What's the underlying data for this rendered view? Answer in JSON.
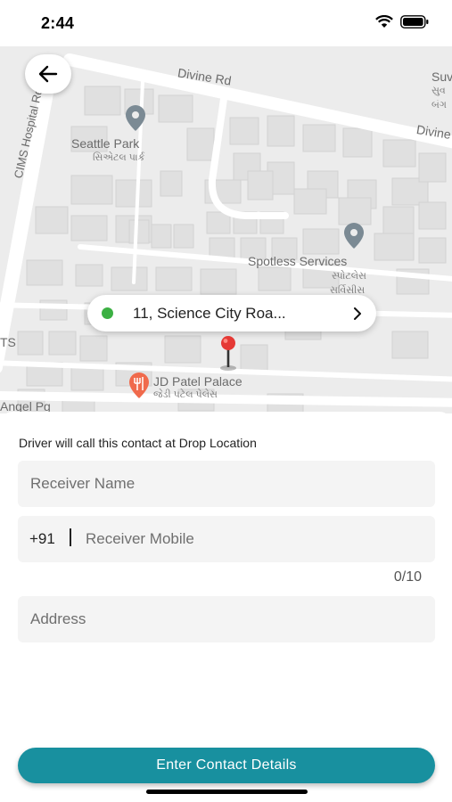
{
  "status_bar": {
    "time": "2:44"
  },
  "map": {
    "roads": {
      "divine_rd": "Divine Rd",
      "divine_right": "Divine",
      "cims_hospital_rd": "CIMS Hospital Rd",
      "angel_pg": "Angel Pg",
      "ts": "TS"
    },
    "places": {
      "seattle_park": {
        "name": "Seattle Park",
        "local": "સિએટલ પાર્ક"
      },
      "spotless_services": {
        "name": "Spotless Services",
        "local": "સ્પોટલેસ",
        "local2": "સર્વિસીસ"
      },
      "jd_patel_palace": {
        "name": "JD Patel Palace",
        "local": "જેડી પટેલ પેલેસ"
      },
      "top_right": {
        "name": "Suv",
        "local": "સુવ",
        "local2": "બંગ"
      }
    },
    "pin_color": "#e53935",
    "poi_icon_color": "#7b8a94"
  },
  "location_chip": {
    "text": "11, Science City Roa...",
    "dot_color": "#3cb043"
  },
  "form": {
    "hint": "Driver will call this contact at Drop Location",
    "receiver_name_placeholder": "Receiver Name",
    "country_code": "+91",
    "receiver_mobile_placeholder": "Receiver Mobile",
    "char_count": "0/10",
    "address_placeholder": "Address"
  },
  "submit_label": "Enter Contact Details",
  "accent_color": "#18909f"
}
